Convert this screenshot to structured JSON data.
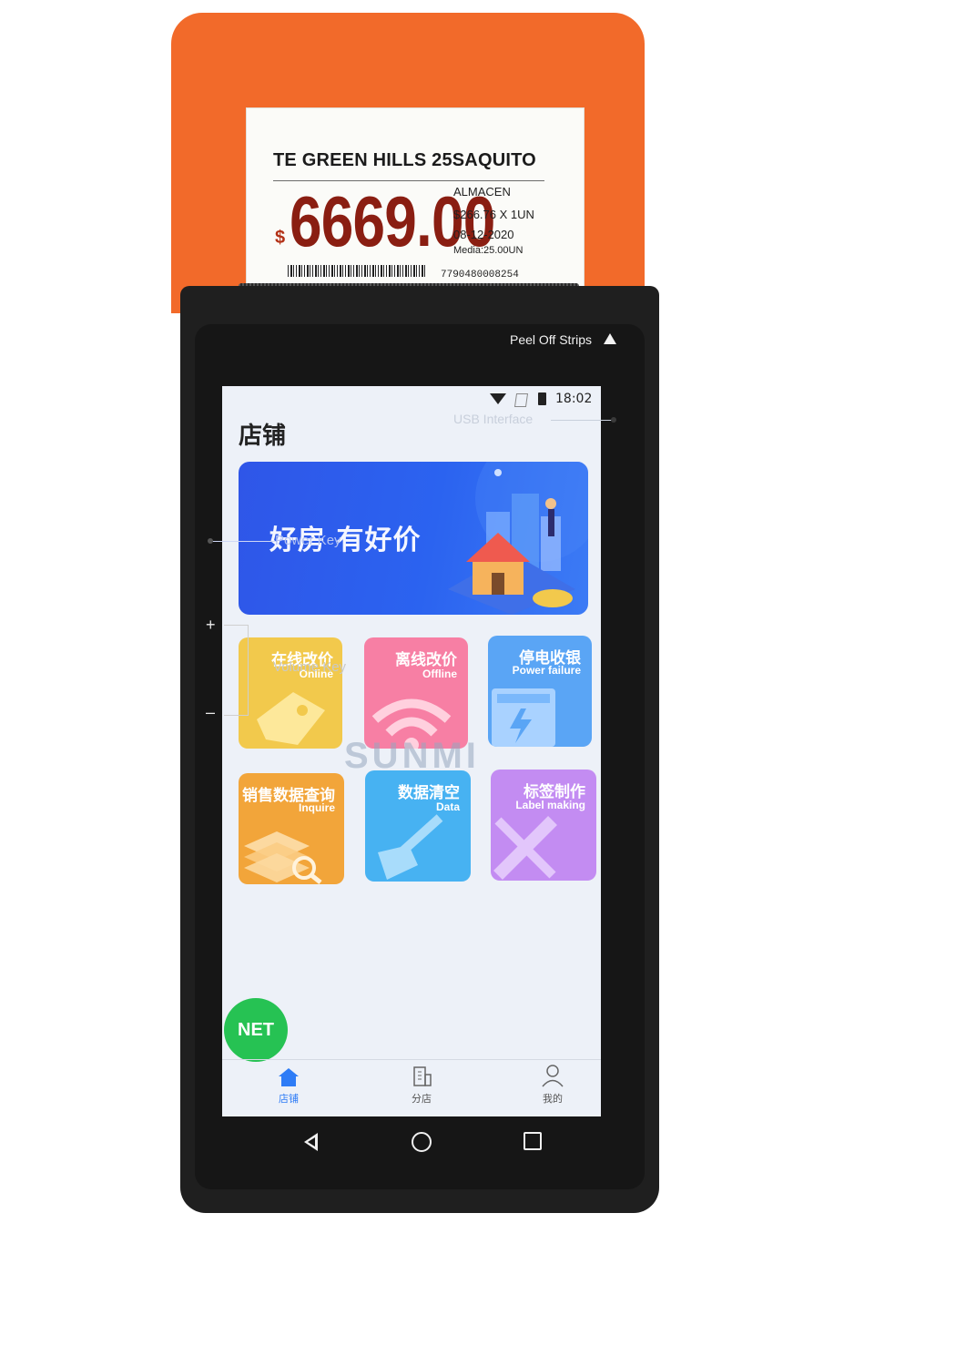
{
  "receipt": {
    "title": "TE GREEN HILLS 25SAQUITO",
    "currency": "$",
    "price": "6669.00",
    "store": "ALMACEN",
    "unit_price": "$266.76 X 1UN",
    "date": "08-12-2020",
    "media": "Media:25.00UN",
    "barcode_number": "7790480008254"
  },
  "device_labels": {
    "peel": "Peel Off Strips",
    "usb": "USB Interface",
    "power": "Power Key",
    "volume": "Volume Key",
    "plus": "+",
    "minus": "–",
    "watermark": "SUNMI"
  },
  "status_bar": {
    "time": "18:02"
  },
  "page": {
    "title": "店铺"
  },
  "banner": {
    "text": "好房 有好价"
  },
  "tiles": [
    {
      "cn": "在线改价",
      "en": "Online",
      "color": "#f2c94c"
    },
    {
      "cn": "离线改价",
      "en": "Offline",
      "color": "#f77fa4"
    },
    {
      "cn": "停电收银",
      "en": "Power failure",
      "color": "#5aa5f5"
    },
    {
      "cn": "销售数据查询",
      "en": "Inquire",
      "color": "#f2a53a"
    },
    {
      "cn": "数据清空",
      "en": "Data",
      "color": "#47b2f2"
    },
    {
      "cn": "标签制作",
      "en": "Label making",
      "color": "#c38cf2"
    }
  ],
  "fab": {
    "label": "NET",
    "color": "#26c253"
  },
  "tabs": [
    {
      "label": "店铺",
      "icon": "home-icon",
      "active": true
    },
    {
      "label": "分店",
      "icon": "building-icon",
      "active": false
    },
    {
      "label": "我的",
      "icon": "user-icon",
      "active": false
    }
  ],
  "colors": {
    "printer": "#f26a2a",
    "accent": "#2e7cf6",
    "banner": "#2b63f0"
  }
}
